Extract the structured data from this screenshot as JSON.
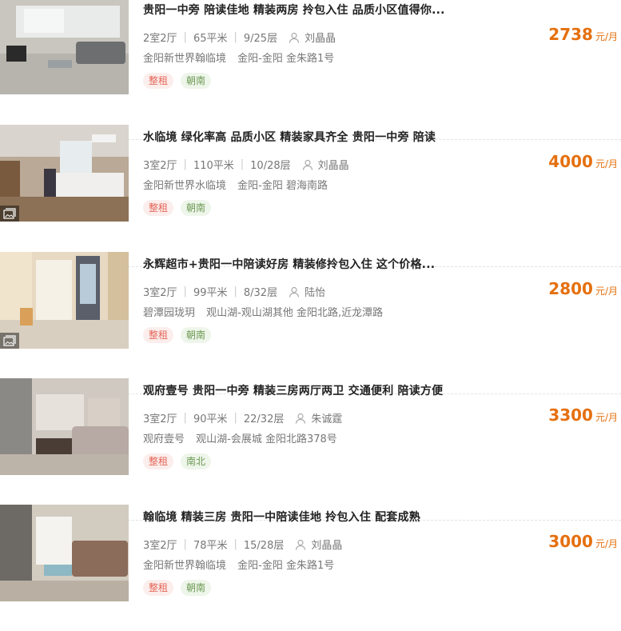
{
  "listings": [
    {
      "title": "贵阳一中旁 陪读佳地 精装两房 拎包入住 品质小区值得你...",
      "layout": "2室2厅",
      "area": "65平米",
      "floor": "9/25层",
      "agent": "刘晶晶",
      "community": "金阳新世界翰临境",
      "location": "金阳-金阳 金朱路1号",
      "tag1": "整租",
      "tag2": "朝南",
      "price": "2738",
      "unit": "元/月",
      "has_gallery": false
    },
    {
      "title": "水临境 绿化率高 品质小区 精装家具齐全 贵阳一中旁 陪读",
      "layout": "3室2厅",
      "area": "110平米",
      "floor": "10/28层",
      "agent": "刘晶晶",
      "community": "金阳新世界水临境",
      "location": "金阳-金阳 碧海南路",
      "tag1": "整租",
      "tag2": "朝南",
      "price": "4000",
      "unit": "元/月",
      "has_gallery": true
    },
    {
      "title": "永辉超市+贵阳一中陪读好房 精装修拎包入住 这个价格...",
      "layout": "3室2厅",
      "area": "99平米",
      "floor": "8/32层",
      "agent": "陆怡",
      "community": "碧潭园珑玥",
      "location": "观山湖-观山湖其他 金阳北路,近龙潭路",
      "tag1": "整租",
      "tag2": "朝南",
      "price": "2800",
      "unit": "元/月",
      "has_gallery": true
    },
    {
      "title": "观府壹号 贵阳一中旁 精装三房两厅两卫 交通便利 陪读方便",
      "layout": "3室2厅",
      "area": "90平米",
      "floor": "22/32层",
      "agent": "朱诚霆",
      "community": "观府壹号",
      "location": "观山湖-会展城 金阳北路378号",
      "tag1": "整租",
      "tag2": "南北",
      "price": "3300",
      "unit": "元/月",
      "has_gallery": false
    },
    {
      "title": "翰临境 精装三房 贵阳一中陪读佳地 拎包入住 配套成熟",
      "layout": "3室2厅",
      "area": "78平米",
      "floor": "15/28层",
      "agent": "刘晶晶",
      "community": "金阳新世界翰临境",
      "location": "金阳-金阳 金朱路1号",
      "tag1": "整租",
      "tag2": "朝南",
      "price": "3000",
      "unit": "元/月",
      "has_gallery": false
    }
  ]
}
